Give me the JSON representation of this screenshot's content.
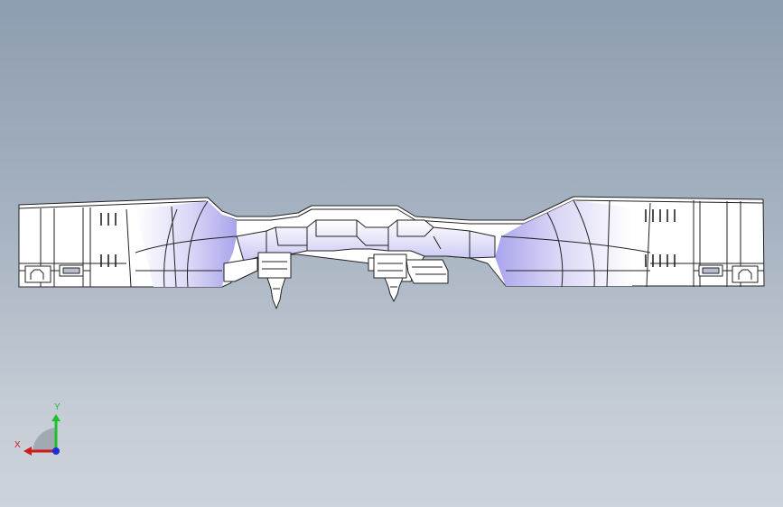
{
  "viewport": {
    "background_top": "#8e9db0",
    "background_bottom": "#cdd3da",
    "part_face_color": "#ffffff",
    "part_shade_color": "#b8b4ee",
    "edge_color": "#222222"
  },
  "triad": {
    "x_label": "X",
    "y_label": "Y",
    "x_color": "#d11b1b",
    "y_color": "#1fbf2a",
    "z_color": "#1a2fd4"
  }
}
